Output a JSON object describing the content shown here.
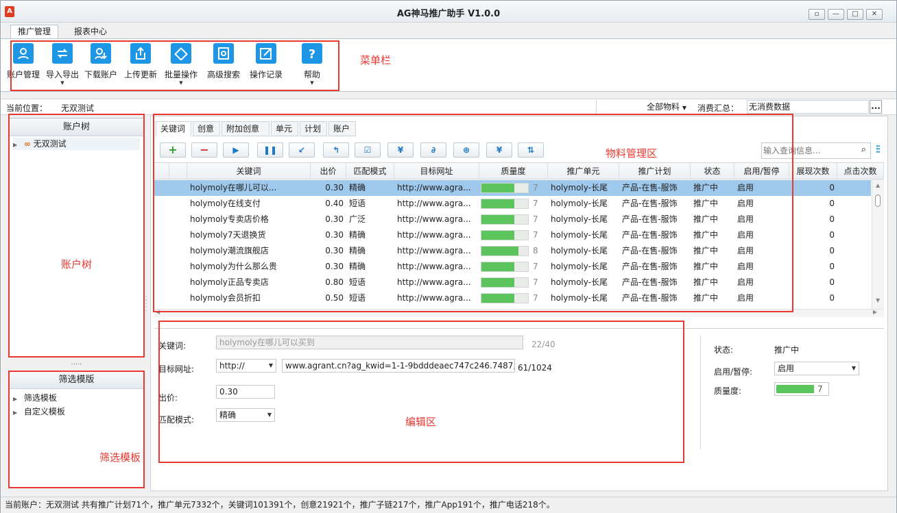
{
  "window": {
    "title": "AG神马推广助手 V1.0.0",
    "icon": "app-icon"
  },
  "main_tabs": [
    {
      "label": "推广管理",
      "active": true
    },
    {
      "label": "报表中心",
      "active": false
    }
  ],
  "ribbon": {
    "buttons": [
      {
        "label": "账户管理",
        "icon": "account-icon",
        "dropdown": false
      },
      {
        "label": "导入导出",
        "icon": "import-export-icon",
        "dropdown": true
      },
      {
        "label": "下载账户",
        "icon": "download-account-icon",
        "dropdown": false
      },
      {
        "label": "上传更新",
        "icon": "upload-icon",
        "dropdown": false
      },
      {
        "label": "批量操作",
        "icon": "batch-icon",
        "dropdown": true
      },
      {
        "label": "高级搜索",
        "icon": "advanced-search-icon",
        "dropdown": false
      },
      {
        "label": "操作记录",
        "icon": "edit-log-icon",
        "dropdown": false
      },
      {
        "label": "帮助",
        "icon": "help-icon",
        "dropdown": true
      }
    ]
  },
  "annotations": {
    "menu": "菜单栏",
    "material": "物料管理区",
    "account_tree": "账户树",
    "filter": "筛选模板",
    "edit": "编辑区"
  },
  "location": {
    "label": "当前位置：",
    "value": "无双测试",
    "filter_select": "全部物料",
    "spend_label": "消费汇总：",
    "spend_value": "无消费数据",
    "more": "..."
  },
  "account_tree": {
    "title": "账户树",
    "items": [
      {
        "label": "无双测试",
        "icon": "link-icon"
      }
    ],
    "splitter": "....."
  },
  "filter_tree": {
    "title": "筛选模版",
    "items": [
      {
        "label": "筛选模板"
      },
      {
        "label": "自定义模板"
      }
    ]
  },
  "sub_tabs": [
    "关键词",
    "创意",
    "附加创意",
    "单元",
    "计划",
    "账户"
  ],
  "toolbar": {
    "buttons": [
      "add-icon",
      "remove-icon",
      "play-icon",
      "pause-icon",
      "arrow-in-icon",
      "arrow-up-icon",
      "check-edit-icon",
      "yen-icon",
      "link-icon",
      "target-icon",
      "yen-batch-icon",
      "sort-icon"
    ],
    "search_placeholder": "输入查询信息...",
    "columns_icon": "columns-icon"
  },
  "table": {
    "columns": [
      "关键词",
      "出价",
      "匹配模式",
      "目标网址",
      "质量度",
      "推广单元",
      "推广计划",
      "状态",
      "启用/暂停",
      "展现次数",
      "点击次数"
    ],
    "rows": [
      {
        "keyword": "holymoly在哪儿可以...",
        "bid": "0.30",
        "match": "精确",
        "url": "http://www.agra...",
        "quality": 7,
        "unit": "holymoly-长尾",
        "plan": "产品-在售-服饰",
        "status": "推广中",
        "enabled": "启用",
        "impressions": "0",
        "selected": true
      },
      {
        "keyword": "holymoly在线支付",
        "bid": "0.40",
        "match": "短语",
        "url": "http://www.agra...",
        "quality": 7,
        "unit": "holymoly-长尾",
        "plan": "产品-在售-服饰",
        "status": "推广中",
        "enabled": "启用",
        "impressions": "0",
        "selected": false
      },
      {
        "keyword": "holymoly专卖店价格",
        "bid": "0.30",
        "match": "广泛",
        "url": "http://www.agra...",
        "quality": 7,
        "unit": "holymoly-长尾",
        "plan": "产品-在售-服饰",
        "status": "推广中",
        "enabled": "启用",
        "impressions": "0",
        "selected": false
      },
      {
        "keyword": "holymoly7天退换货",
        "bid": "0.30",
        "match": "精确",
        "url": "http://www.agra...",
        "quality": 7,
        "unit": "holymoly-长尾",
        "plan": "产品-在售-服饰",
        "status": "推广中",
        "enabled": "启用",
        "impressions": "0",
        "selected": false
      },
      {
        "keyword": "holymoly潮流旗舰店",
        "bid": "0.30",
        "match": "精确",
        "url": "http://www.agra...",
        "quality": 8,
        "unit": "holymoly-长尾",
        "plan": "产品-在售-服饰",
        "status": "推广中",
        "enabled": "启用",
        "impressions": "0",
        "selected": false
      },
      {
        "keyword": "holymoly为什么那么贵",
        "bid": "0.30",
        "match": "精确",
        "url": "http://www.agra...",
        "quality": 7,
        "unit": "holymoly-长尾",
        "plan": "产品-在售-服饰",
        "status": "推广中",
        "enabled": "启用",
        "impressions": "0",
        "selected": false
      },
      {
        "keyword": "holymoly正品专卖店",
        "bid": "0.80",
        "match": "短语",
        "url": "http://www.agra...",
        "quality": 7,
        "unit": "holymoly-长尾",
        "plan": "产品-在售-服饰",
        "status": "推广中",
        "enabled": "启用",
        "impressions": "0",
        "selected": false
      },
      {
        "keyword": "holymoly会员折扣",
        "bid": "0.50",
        "match": "短语",
        "url": "http://www.agra...",
        "quality": 7,
        "unit": "holymoly-长尾",
        "plan": "产品-在售-服饰",
        "status": "推广中",
        "enabled": "启用",
        "impressions": "0",
        "selected": false
      }
    ],
    "splitter": "....."
  },
  "editor": {
    "keyword_label": "关键词:",
    "keyword_value": "holymoly在哪儿可以买到",
    "keyword_count": "22/40",
    "url_label": "目标网址:",
    "url_protocol": "http://",
    "url_value": "www.agrant.cn?ag_kwid=1-1-9bdddeaec747c246.7487;",
    "url_count": "61/1024",
    "bid_label": "出价:",
    "bid_value": "0.30",
    "match_label": "匹配模式:",
    "match_value": "精确",
    "status_label": "状态:",
    "status_value": "推广中",
    "enable_label": "启用/暂停:",
    "enable_value": "启用",
    "quality_label": "质量度:",
    "quality_value": 7
  },
  "statusbar": {
    "text": "当前账户：无双测试 共有推广计划71个，推广单元7332个，关键词101391个，创意21921个，推广子链217个，推广App191个，推广电话218个。"
  }
}
